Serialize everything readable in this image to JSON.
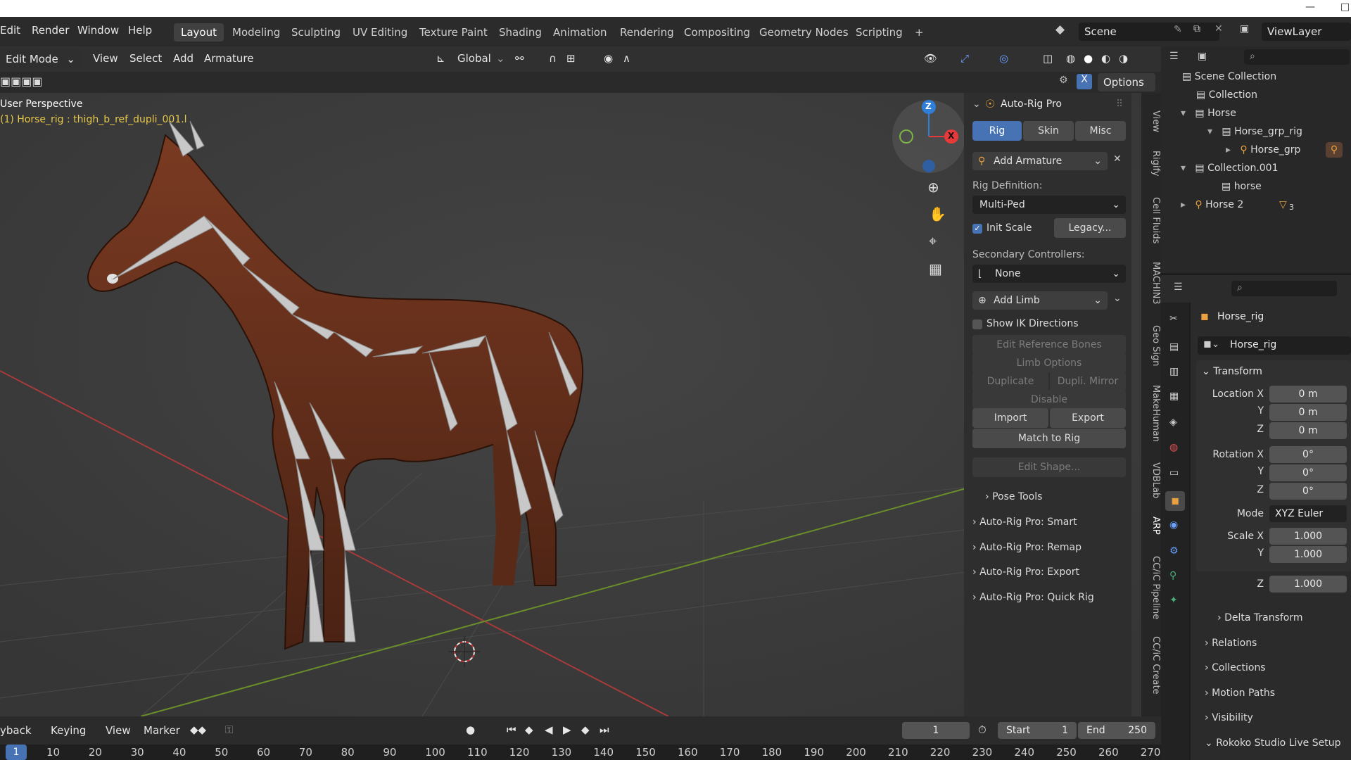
{
  "menu": {
    "items": [
      "Edit",
      "Render",
      "Window",
      "Help"
    ]
  },
  "workspaces": {
    "tabs": [
      "Layout",
      "Modeling",
      "Sculpting",
      "UV Editing",
      "Texture Paint",
      "Shading",
      "Animation",
      "Rendering",
      "Compositing",
      "Geometry Nodes",
      "Scripting"
    ],
    "active": "Layout",
    "add": "+"
  },
  "scene": {
    "label": "Scene",
    "viewlayer": "ViewLayer"
  },
  "header": {
    "mode": "Edit Mode",
    "menus": [
      "View",
      "Select",
      "Add",
      "Armature"
    ],
    "transform_orientation": "Global",
    "options_label": "Options"
  },
  "viewport": {
    "perspective": "User Perspective",
    "active_info": "(1) Horse_rig : thigh_b_ref_dupli_001.l",
    "gizmo_axes": [
      "Z",
      "X"
    ]
  },
  "npanel": {
    "title": "Auto-Rig Pro",
    "tabs": [
      "Rig",
      "Skin",
      "Misc"
    ],
    "active_tab": "Rig",
    "add_armature": "Add Armature",
    "rig_definition_label": "Rig Definition:",
    "rig_definition_value": "Multi-Ped",
    "init_scale": "Init Scale",
    "legacy": "Legacy...",
    "secondary_label": "Secondary Controllers:",
    "secondary_value": "None",
    "add_limb": "Add Limb",
    "show_ik": "Show IK Directions",
    "edit_ref_bones": "Edit Reference Bones",
    "limb_options": "Limb Options",
    "duplicate": "Duplicate",
    "dupli_mirror": "Dupli. Mirror",
    "disable": "Disable",
    "import": "Import",
    "export": "Export",
    "match_to_rig": "Match to Rig",
    "edit_shape": "Edit Shape...",
    "pose_tools": "Pose Tools",
    "subpanels": [
      "Auto-Rig Pro: Smart",
      "Auto-Rig Pro: Remap",
      "Auto-Rig Pro: Export",
      "Auto-Rig Pro: Quick Rig"
    ]
  },
  "vertical_tabs": [
    "View",
    "Rigify",
    "Cell Fluids",
    "MACHIN3",
    "Geo Sign",
    "MakeHuman",
    "VDBLab",
    "ARP",
    "CC/iC Pipeline",
    "CC/iC Create"
  ],
  "outliner": {
    "rows": [
      {
        "label": "Scene Collection"
      },
      {
        "label": "Collection"
      },
      {
        "label": "Horse"
      },
      {
        "label": "Horse_grp_rig"
      },
      {
        "label": "Horse_grp"
      },
      {
        "label": "Collection.001"
      },
      {
        "label": "horse"
      },
      {
        "label": "Horse 2",
        "badge": "3"
      }
    ]
  },
  "properties": {
    "object_name": "Horse_rig",
    "datablock": "Horse_rig",
    "transform_title": "Transform",
    "location_label": "Location X",
    "location": [
      "0 m",
      "0 m",
      "0 m"
    ],
    "rotation_label": "Rotation X",
    "rotation": [
      "0°",
      "0°",
      "0°"
    ],
    "mode_label": "Mode",
    "mode_value": "XYZ Euler",
    "scale_label": "Scale X",
    "scale": [
      "1.000",
      "1.000",
      "1.000"
    ],
    "axis_y": "Y",
    "axis_z": "Z",
    "sections": [
      "Delta Transform",
      "Relations",
      "Collections",
      "Motion Paths",
      "Visibility",
      "Rokoko Studio Live Setup"
    ]
  },
  "timeline": {
    "menus": [
      "yback",
      "Keying",
      "View",
      "Marker"
    ],
    "current_frame": "1",
    "start_label": "Start",
    "start": "1",
    "end_label": "End",
    "end": "250",
    "ruler": [
      "1",
      "10",
      "20",
      "30",
      "40",
      "50",
      "60",
      "70",
      "80",
      "90",
      "100",
      "110",
      "120",
      "130",
      "140",
      "150",
      "160",
      "170",
      "180",
      "190",
      "200",
      "210",
      "220",
      "230",
      "240",
      "250",
      "260",
      "270"
    ]
  },
  "colors": {
    "accent": "#4772b3",
    "info_text": "#e6c84a",
    "axis_x": "#e63a3a",
    "axis_y": "#7cb342",
    "axis_z": "#2f7ed8"
  }
}
